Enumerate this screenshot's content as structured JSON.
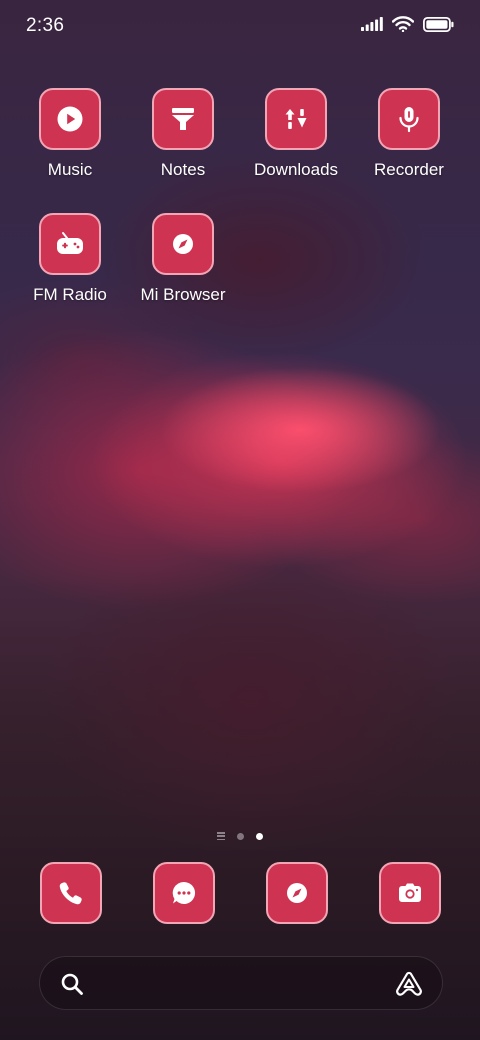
{
  "status_bar": {
    "time": "2:36",
    "icons": [
      "signal-icon",
      "wifi-icon",
      "battery-icon"
    ]
  },
  "apps": [
    {
      "label": "Music",
      "icon": "play-icon"
    },
    {
      "label": "Notes",
      "icon": "notes-icon"
    },
    {
      "label": "Downloads",
      "icon": "downloads-icon"
    },
    {
      "label": "Recorder",
      "icon": "microphone-icon"
    },
    {
      "label": "FM Radio",
      "icon": "radio-icon"
    },
    {
      "label": "Mi Browser",
      "icon": "compass-icon"
    }
  ],
  "page_indicator": {
    "pages": 2,
    "active_page": 2
  },
  "dock": [
    {
      "icon": "phone-icon"
    },
    {
      "icon": "messages-icon"
    },
    {
      "icon": "compass-icon"
    },
    {
      "icon": "camera-icon"
    }
  ],
  "search_bar": {
    "icon": "search-icon",
    "assistant_icon": "assistant-icon"
  },
  "colors": {
    "icon_fill": "#cf3352",
    "icon_border": "#f1a5b5"
  }
}
